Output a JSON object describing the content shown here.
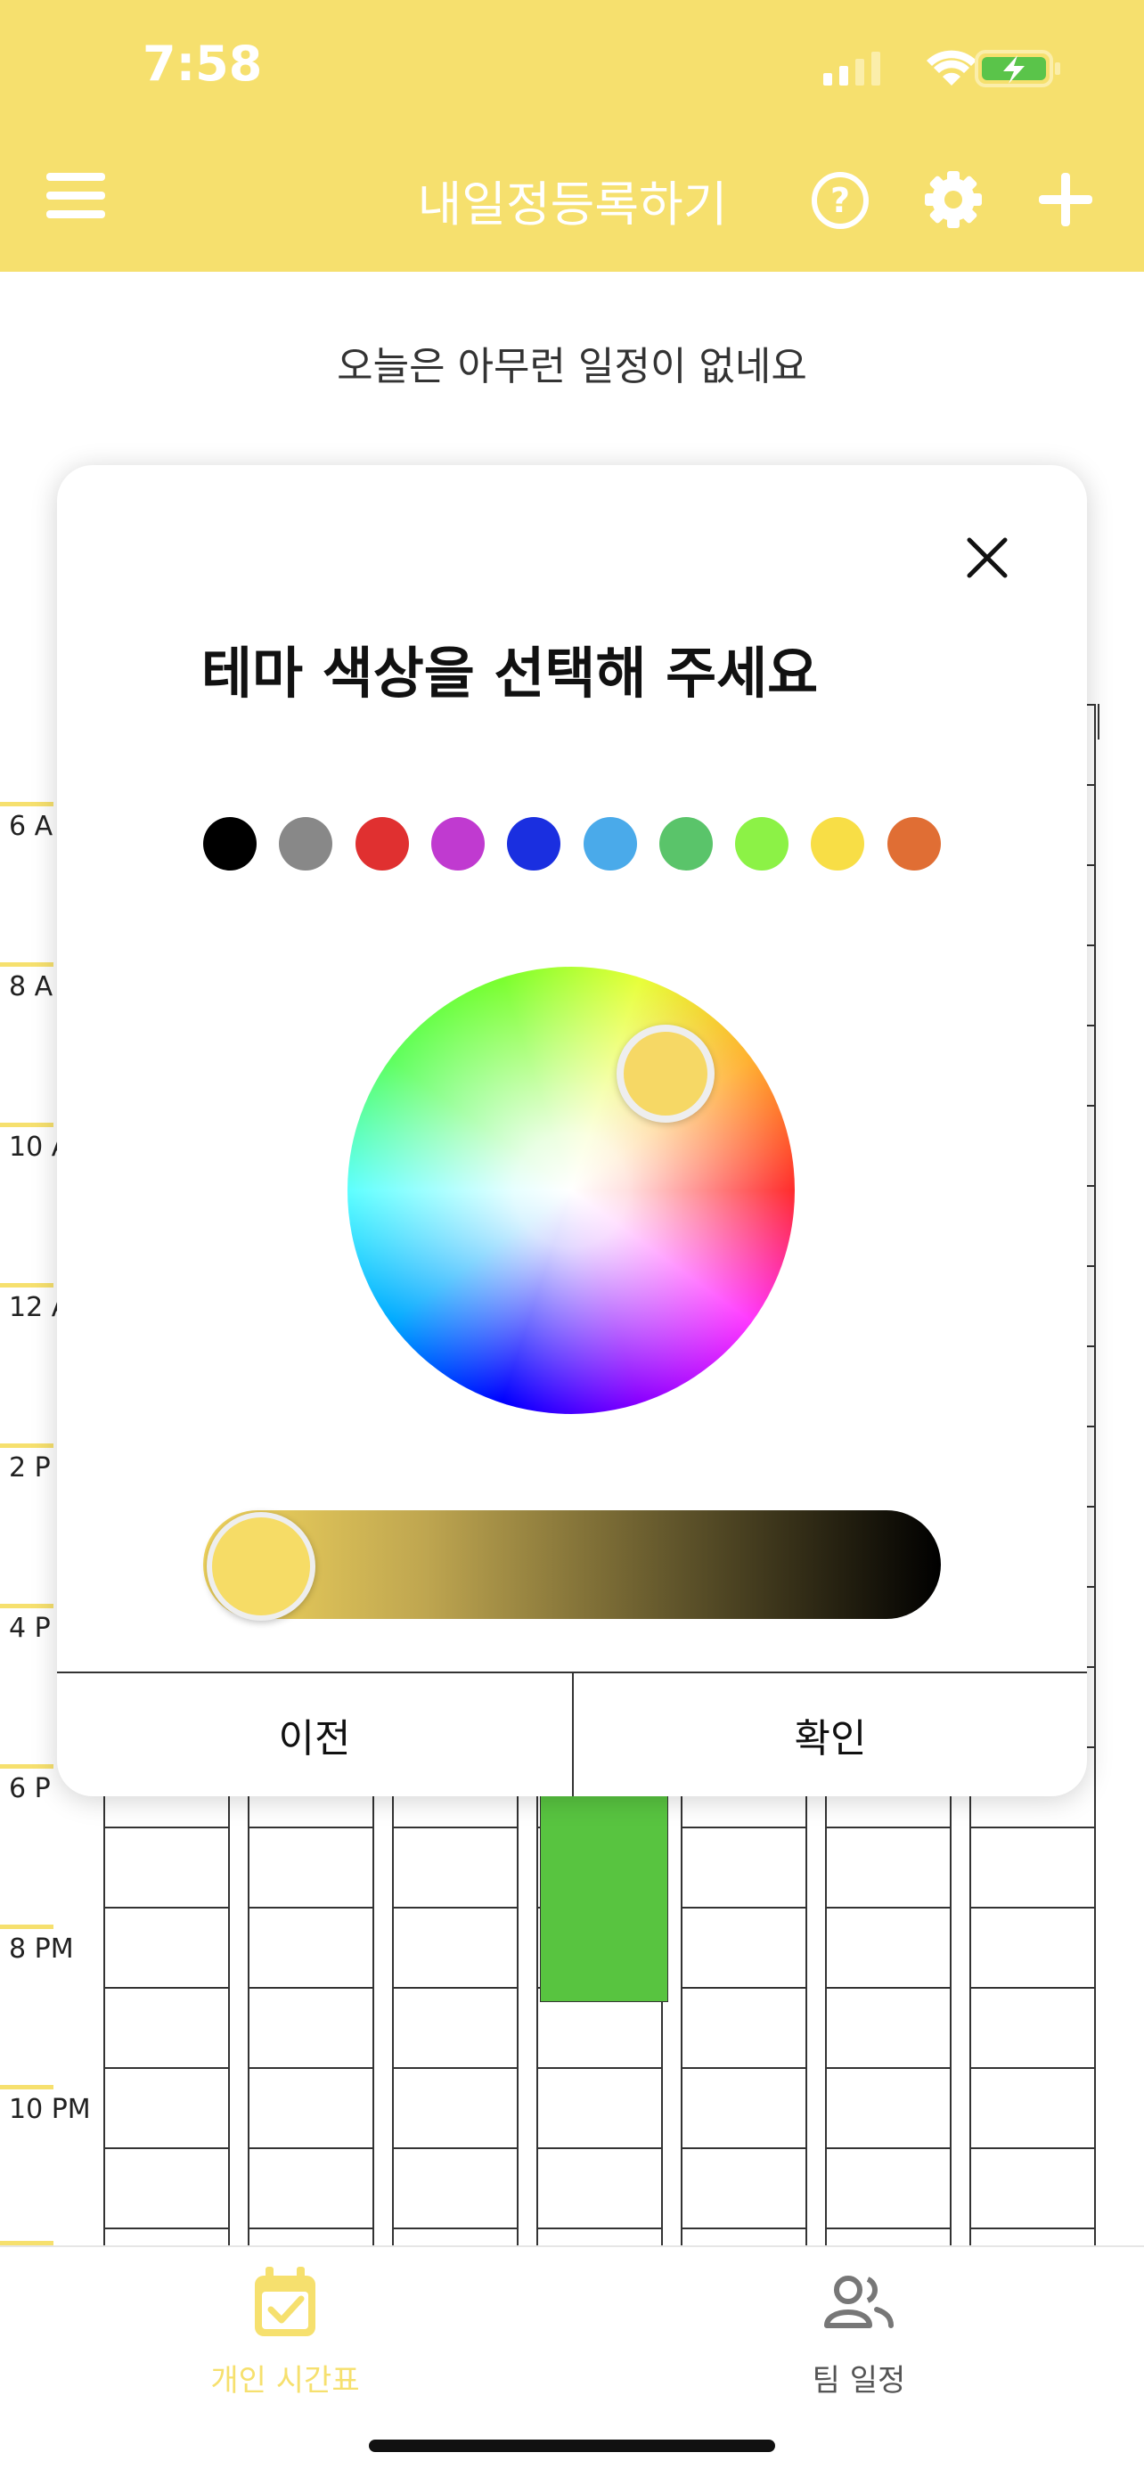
{
  "status_bar": {
    "time": "7:58"
  },
  "header": {
    "title": "내일정등록하기",
    "menu_icon": "hamburger-icon",
    "help_icon": "help-circle-icon",
    "settings_icon": "gear-icon",
    "add_icon": "plus-icon"
  },
  "notice": "오늘은 아무런 일정이 없네요",
  "time_labels": [
    "6 A",
    "8 A",
    "10 A",
    "12 A",
    "2 P",
    "4 P",
    "6 P",
    "8 PM",
    "10 PM"
  ],
  "modal": {
    "title": "테마 색상을 선택해 주세요",
    "swatches": [
      "#000000",
      "#888888",
      "#e03030",
      "#c03ad0",
      "#1a2fe0",
      "#4aaaea",
      "#5ac46a",
      "#8cf246",
      "#f8de46",
      "#e06e34"
    ],
    "selected_color": "#f6d865",
    "brightness": 1.0,
    "prev_label": "이전",
    "confirm_label": "확인"
  },
  "tabs": [
    {
      "label": "개인 시간표",
      "icon": "calendar-check-icon",
      "active": true,
      "color": "#f6e06e"
    },
    {
      "label": "팀 일정",
      "icon": "people-icon",
      "active": false,
      "color": "#777777"
    }
  ],
  "colors": {
    "accent": "#f6e06e",
    "event_block": "#58c440"
  }
}
